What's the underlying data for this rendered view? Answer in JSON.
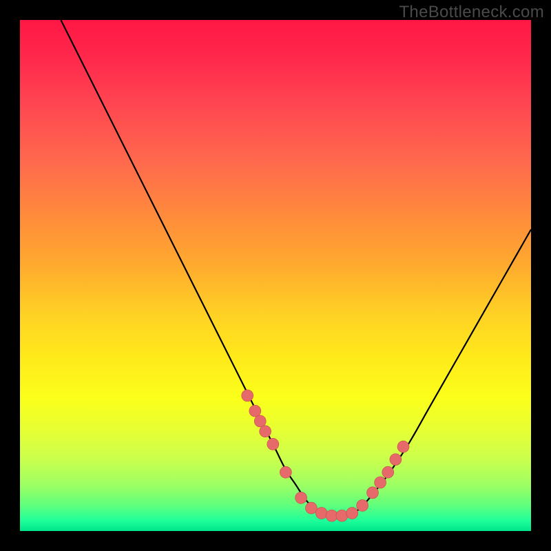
{
  "watermark": {
    "text": "TheBottleneck.com"
  },
  "chart_data": {
    "type": "line",
    "title": "",
    "xlabel": "",
    "ylabel": "",
    "xlim": [
      0,
      100
    ],
    "ylim": [
      0,
      100
    ],
    "grid": false,
    "legend": false,
    "curve": {
      "x": [
        8,
        12,
        16,
        20,
        24,
        28,
        32,
        36,
        40,
        44,
        48,
        50,
        52,
        54,
        56,
        58,
        60,
        62,
        64,
        66,
        68,
        72,
        76,
        80,
        84,
        88,
        92,
        96,
        100
      ],
      "y": [
        100,
        92,
        84,
        76,
        68,
        60,
        52,
        44,
        36,
        28,
        20,
        16,
        12,
        9,
        6,
        4,
        3,
        3,
        3,
        4,
        6,
        11,
        17,
        24,
        31,
        38,
        45,
        52,
        59
      ]
    },
    "markers": {
      "x": [
        44.5,
        46.0,
        47.0,
        48.0,
        49.5,
        52.0,
        55.0,
        57.0,
        59.0,
        61.0,
        63.0,
        65.0,
        67.0,
        69.0,
        70.5,
        72.0,
        73.5,
        75.0
      ],
      "y": [
        26.5,
        23.5,
        21.5,
        19.5,
        17.0,
        11.5,
        6.5,
        4.5,
        3.5,
        3.0,
        3.0,
        3.5,
        5.0,
        7.5,
        9.5,
        11.5,
        14.0,
        16.5
      ]
    },
    "colors": {
      "curve_stroke": "#000000",
      "marker_fill": "#e66a6a",
      "marker_stroke": "#c64a4a"
    }
  }
}
